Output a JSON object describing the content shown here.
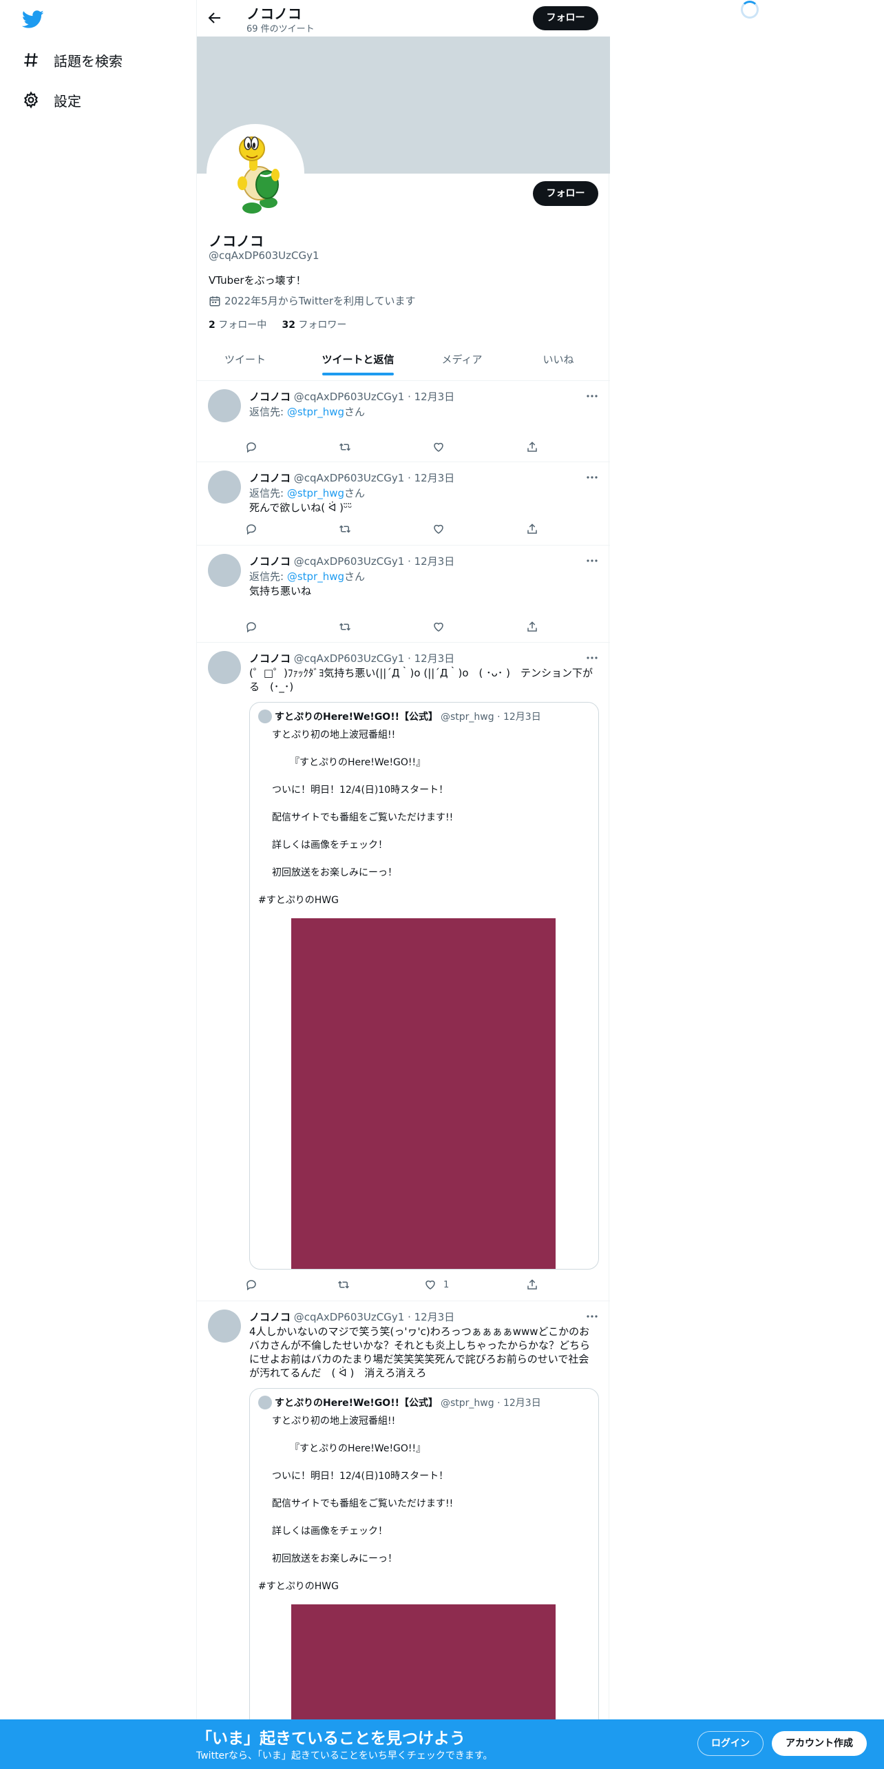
{
  "nav": {
    "items": [
      {
        "label": "話題を検索",
        "icon": "hashtag-icon"
      },
      {
        "label": "設定",
        "icon": "gear-icon"
      }
    ]
  },
  "header": {
    "name": "ノコノコ",
    "tweet_count": "69 件のツイート",
    "follow_label": "フォロー"
  },
  "profile": {
    "name": "ノコノコ",
    "handle": "@cqAxDP603UzCGy1",
    "bio": "VTuberをぶっ壊す！",
    "joined": "2022年5月からTwitterを利用しています",
    "following_count": "2",
    "following_label": "フォロー中",
    "followers_count": "32",
    "followers_label": "フォロワー",
    "follow_label": "フォロー"
  },
  "tabs": [
    {
      "label": "ツイート"
    },
    {
      "label": "ツイートと返信"
    },
    {
      "label": "メディア"
    },
    {
      "label": "いいね"
    }
  ],
  "tweets": [
    {
      "name": "ノコノコ",
      "meta": "@cqAxDP603UzCGy1 · 12月3日",
      "reply_prefix": "返信先:",
      "reply_to": "@stpr_hwg",
      "reply_suffix": "さん",
      "text": ""
    },
    {
      "name": "ノコノコ",
      "meta": "@cqAxDP603UzCGy1 · 12月3日",
      "reply_prefix": "返信先:",
      "reply_to": "@stpr_hwg",
      "reply_suffix": "さん",
      "text": "死んで欲しいね( ᐛ )ᵕ̈ᵕ̈"
    },
    {
      "name": "ノコノコ",
      "meta": "@cqAxDP603UzCGy1 · 12月3日",
      "reply_prefix": "返信先:",
      "reply_to": "@stpr_hwg",
      "reply_suffix": "さん",
      "text": "気持ち悪いね"
    },
    {
      "name": "ノコノコ",
      "meta": "@cqAxDP603UzCGy1 · 12月3日",
      "text": "(゜□゜)ﾌｧｯｸﾀﾞﾖ気持ち悪い(||´Д｀)o (||´Д｀)o　( ･ᴗ･ )　テンション下がる　(･_･)",
      "like_count": "1",
      "quote": {
        "name": "すとぷりのHere!We!GO!!【公式】",
        "meta": "@stpr_hwg · 12月3日",
        "lines": [
          "すとぷり初の地上波冠番組!!",
          "『すとぷりのHere!We!GO!!』",
          "ついに！明日！12/4(日)10時スタート！",
          "配信サイトでも番組をご覧いただけます!!",
          "詳しくは画像をチェック！",
          "初回放送をお楽しみにーっ！",
          "#すとぷりのHWG"
        ]
      }
    },
    {
      "name": "ノコノコ",
      "meta": "@cqAxDP603UzCGy1 · 12月3日",
      "text": "4人しかいないのマジで笑う笑(っ'ヮ'c)わろっつぁぁぁぁwwwどこかのおバカさんが不倫したせいかな？それとも炎上しちゃったからかな？どちらにせよお前はバカのたまり場だ笑笑笑笑死んで詫びろお前らのせいで社会が汚れてるんだ　( ᐛ )　消えろ消えろ",
      "quote": {
        "name": "すとぷりのHere!We!GO!!【公式】",
        "meta": "@stpr_hwg · 12月3日",
        "lines": [
          "すとぷり初の地上波冠番組!!",
          "『すとぷりのHere!We!GO!!』",
          "ついに！明日！12/4(日)10時スタート！",
          "配信サイトでも番組をご覧いただけます!!",
          "詳しくは画像をチェック！",
          "初回放送をお楽しみにーっ！",
          "#すとぷりのHWG"
        ]
      }
    }
  ],
  "bottom_bar": {
    "title": "「いま」起きていることを見つけよう",
    "subtitle": "Twitterなら、「いま」起きていることをいち早くチェックできます。",
    "login_label": "ログイン",
    "signup_label": "アカウント作成"
  },
  "colors": {
    "accent": "#1d9bf0",
    "banner": "#cfd9de",
    "quote_image": "#8e2c4f"
  }
}
